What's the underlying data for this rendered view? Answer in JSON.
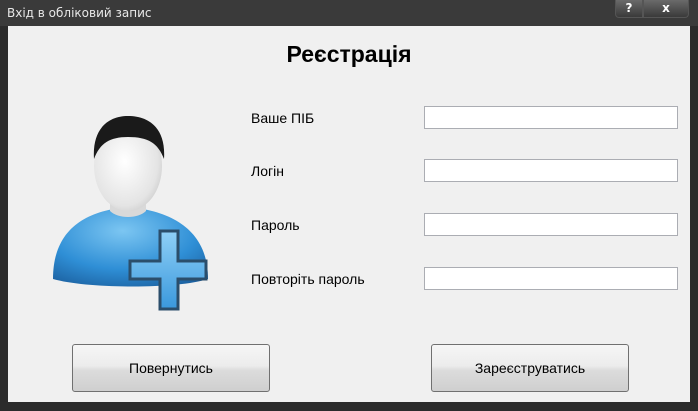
{
  "window": {
    "title": "Вхід в обліковий запис"
  },
  "controls": {
    "help": "?",
    "close": "x"
  },
  "form": {
    "heading": "Реєстрація",
    "fields": [
      {
        "label": "Ваше ПІБ",
        "value": ""
      },
      {
        "label": "Логін",
        "value": ""
      },
      {
        "label": "Пароль",
        "value": ""
      },
      {
        "label": "Повторіть пароль",
        "value": ""
      }
    ]
  },
  "buttons": {
    "back": "Повернутись",
    "register": "Зареєструватись"
  },
  "icon": {
    "name": "user-add-icon",
    "person_color": "#3aa0e0",
    "plus_color": "#5fb2e8"
  }
}
